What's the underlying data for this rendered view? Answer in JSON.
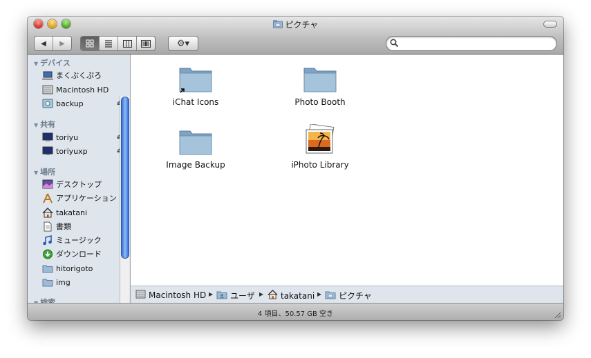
{
  "window": {
    "title": "ピクチャ"
  },
  "toolbar": {
    "back_label": "◀",
    "forward_label": "▶",
    "action_label": "⚙▾",
    "search_placeholder": ""
  },
  "sidebar": {
    "sections": [
      {
        "heading": "デバイス",
        "items": [
          {
            "label": "まくぶくぷろ",
            "icon": "laptop-icon"
          },
          {
            "label": "Macintosh HD",
            "icon": "hard-drive-icon"
          },
          {
            "label": "backup",
            "icon": "external-drive-icon",
            "eject": true
          }
        ]
      },
      {
        "heading": "共有",
        "items": [
          {
            "label": "toriyu",
            "icon": "display-icon",
            "eject": true
          },
          {
            "label": "toriyuxp",
            "icon": "display-icon",
            "eject": true
          }
        ]
      },
      {
        "heading": "場所",
        "items": [
          {
            "label": "デスクトップ",
            "icon": "desktop-icon"
          },
          {
            "label": "アプリケーション",
            "icon": "applications-icon"
          },
          {
            "label": "takatani",
            "icon": "home-icon"
          },
          {
            "label": "書類",
            "icon": "documents-icon"
          },
          {
            "label": "ミュージック",
            "icon": "music-icon"
          },
          {
            "label": "ダウンロード",
            "icon": "downloads-icon"
          },
          {
            "label": "hitorigoto",
            "icon": "folder-icon"
          },
          {
            "label": "img",
            "icon": "folder-icon"
          }
        ]
      },
      {
        "heading": "検索",
        "items": []
      }
    ]
  },
  "files": [
    {
      "label": "iChat Icons",
      "icon": "folder-alias-icon"
    },
    {
      "label": "Photo Booth",
      "icon": "folder-icon"
    },
    {
      "label": "Image Backup",
      "icon": "folder-icon"
    },
    {
      "label": "iPhoto Library",
      "icon": "iphoto-library-icon"
    }
  ],
  "pathbar": [
    {
      "label": "Macintosh HD",
      "icon": "hard-drive-icon"
    },
    {
      "label": "ユーザ",
      "icon": "users-folder-icon"
    },
    {
      "label": "takatani",
      "icon": "home-icon"
    },
    {
      "label": "ピクチャ",
      "icon": "pictures-folder-icon"
    }
  ],
  "status": {
    "text": "4 項目、50.57 GB 空き"
  },
  "colors": {
    "sidebar_bg": "#dfe5ec",
    "sidebar_heading": "#6c7c8c",
    "scroll_thumb": "#2d6fd6"
  }
}
